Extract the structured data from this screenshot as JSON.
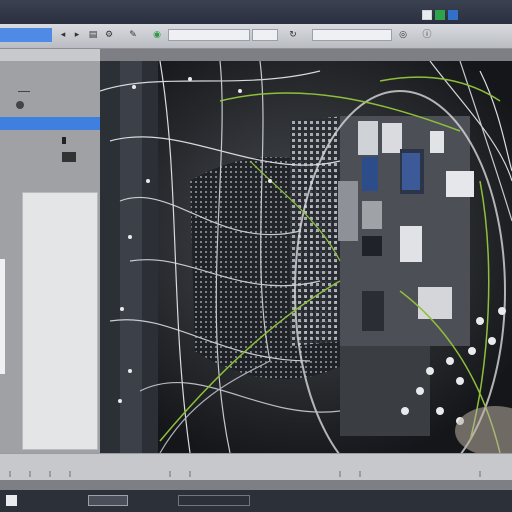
{
  "window": {
    "controls": [
      "minimize-icon",
      "maximize-icon",
      "close-icon"
    ],
    "accent_green": "#2fa34a",
    "accent_blue": "#3370c9"
  },
  "toolbar": {
    "icons": [
      "back-icon",
      "forward-icon",
      "layers-icon",
      "settings-icon",
      "brush-icon",
      "zoom-icon",
      "refresh-icon",
      "target-icon"
    ],
    "field_1": "",
    "field_2": "",
    "field_3": ""
  },
  "left_panel": {
    "selected_item": ""
  },
  "status_bar": {
    "text": ""
  },
  "bottom_bar": {
    "field_value": "",
    "right_text": ""
  },
  "canvas": {
    "description_icon": "image-canvas"
  }
}
